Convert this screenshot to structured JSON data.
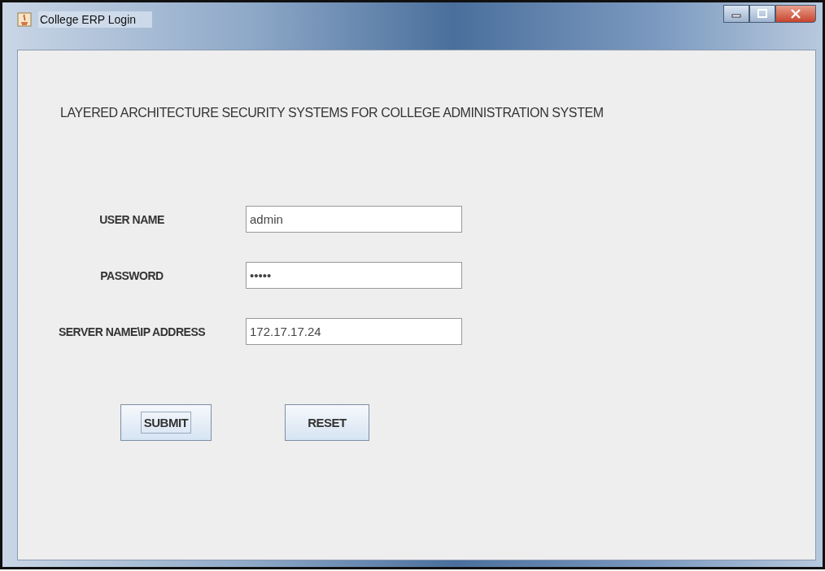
{
  "window": {
    "title": "College ERP Login"
  },
  "heading": "LAYERED ARCHITECTURE SECURITY SYSTEMS FOR COLLEGE ADMINISTRATION SYSTEM",
  "fields": [
    {
      "label": "USER NAME",
      "value": "admin"
    },
    {
      "label": "PASSWORD",
      "value": "•••••"
    },
    {
      "label": "SERVER NAME\\IP  ADDRESS",
      "value": "172.17.17.24"
    }
  ],
  "buttons": [
    {
      "label": "SUBMIT",
      "focused": true
    },
    {
      "label": "RESET",
      "focused": false
    }
  ]
}
